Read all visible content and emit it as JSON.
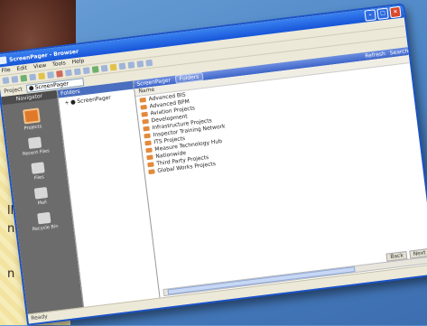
{
  "window": {
    "title": "ScreenPager - Browser"
  },
  "menu": [
    "File",
    "Edit",
    "View",
    "Tools",
    "Help"
  ],
  "address": {
    "label": "Project",
    "value": "ScreenPager"
  },
  "nav": {
    "header": "Navigator",
    "items": [
      {
        "label": "Projects",
        "icon": "projects-icon"
      },
      {
        "label": "Recent Files",
        "icon": "recent-files-icon"
      },
      {
        "label": "Files",
        "icon": "files-icon"
      },
      {
        "label": "Mail",
        "icon": "mail-icon"
      },
      {
        "label": "Recycle Bin",
        "icon": "recycle-bin-icon"
      }
    ]
  },
  "tree": {
    "header": "Folders",
    "root": "ScreenPager"
  },
  "list": {
    "header_title": "ScreenPager",
    "tab": "Folders",
    "right_actions": [
      "Refresh",
      "Search"
    ],
    "column": "Name",
    "rows": [
      "Advanced BIS",
      "Advanced BPM",
      "Aviation Projects",
      "Development",
      "Infrastructure Projects",
      "Inspector Training Network",
      "ITS Projects",
      "Measure Technology Hub",
      "Nationwide",
      "Third Party Projects",
      "Global Works Projects"
    ]
  },
  "pager": [
    "Back",
    "Next"
  ],
  "status": {
    "text": "Ready"
  },
  "background": {
    "lines": [
      "ll",
      "n",
      "n"
    ]
  }
}
